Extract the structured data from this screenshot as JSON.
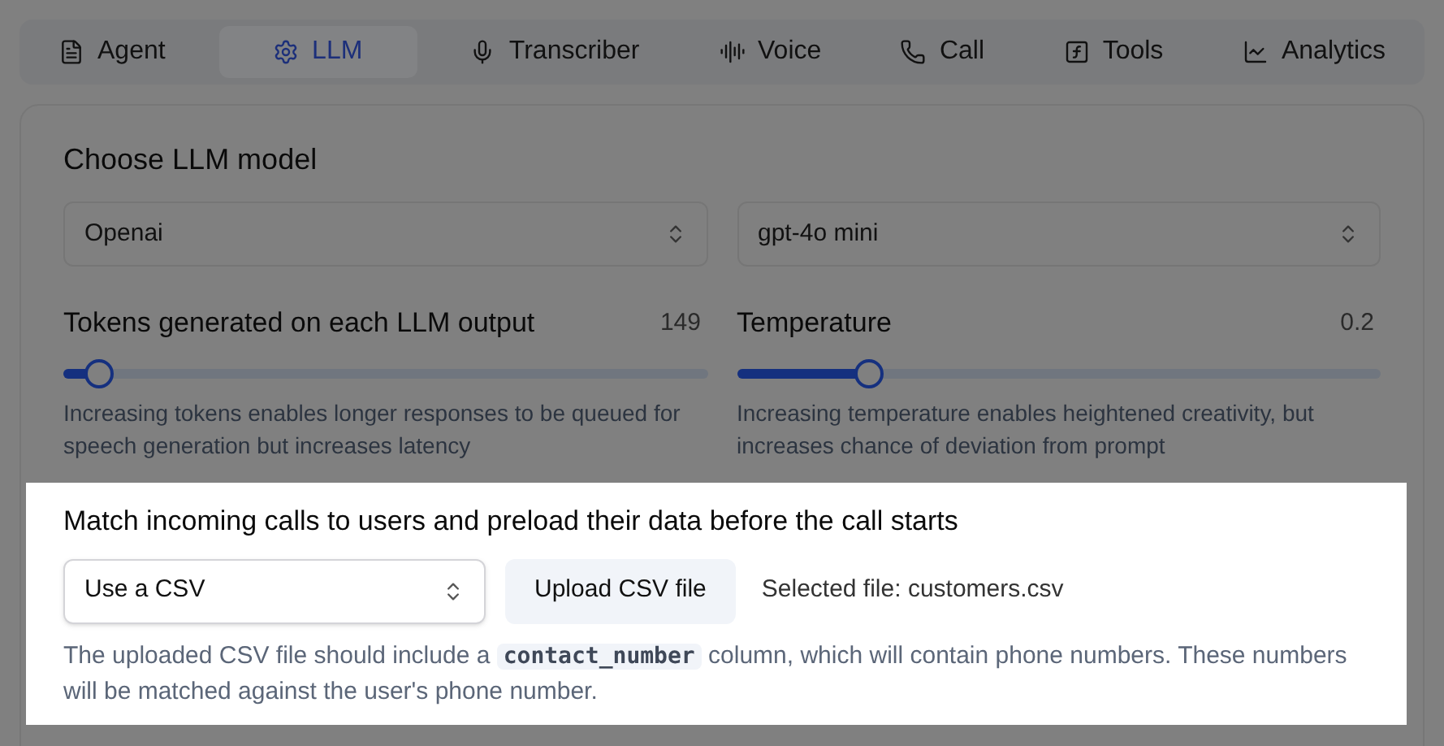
{
  "tabs": [
    {
      "label": "Agent",
      "selected": false
    },
    {
      "label": "LLM",
      "selected": true
    },
    {
      "label": "Transcriber",
      "selected": false
    },
    {
      "label": "Voice",
      "selected": false
    },
    {
      "label": "Call",
      "selected": false
    },
    {
      "label": "Tools",
      "selected": false
    },
    {
      "label": "Analytics",
      "selected": false
    }
  ],
  "llm": {
    "title": "Choose LLM model",
    "provider": "Openai",
    "model": "gpt-4o mini",
    "sliders": [
      {
        "label": "Tokens generated on each LLM output",
        "reading": "149",
        "level": 0.056,
        "help": "Increasing tokens enables longer responses to be queued for speech generation but increases latency"
      },
      {
        "label": "Temperature",
        "reading": "0.2",
        "level": 0.206,
        "help": "Increasing temperature enables heightened creativity, but increases chance of deviation from prompt"
      }
    ]
  },
  "matching": {
    "title": "Match incoming calls to users and preload their data before the call starts",
    "source": "Use a CSV",
    "upload_button": "Upload CSV file",
    "selected_file": "Selected file: customers.csv",
    "note": {
      "before": "The uploaded CSV file should include a ",
      "code": "contact_number",
      "after": " column, which will contain phone numbers. These numbers will be matched against the user's phone number."
    }
  }
}
